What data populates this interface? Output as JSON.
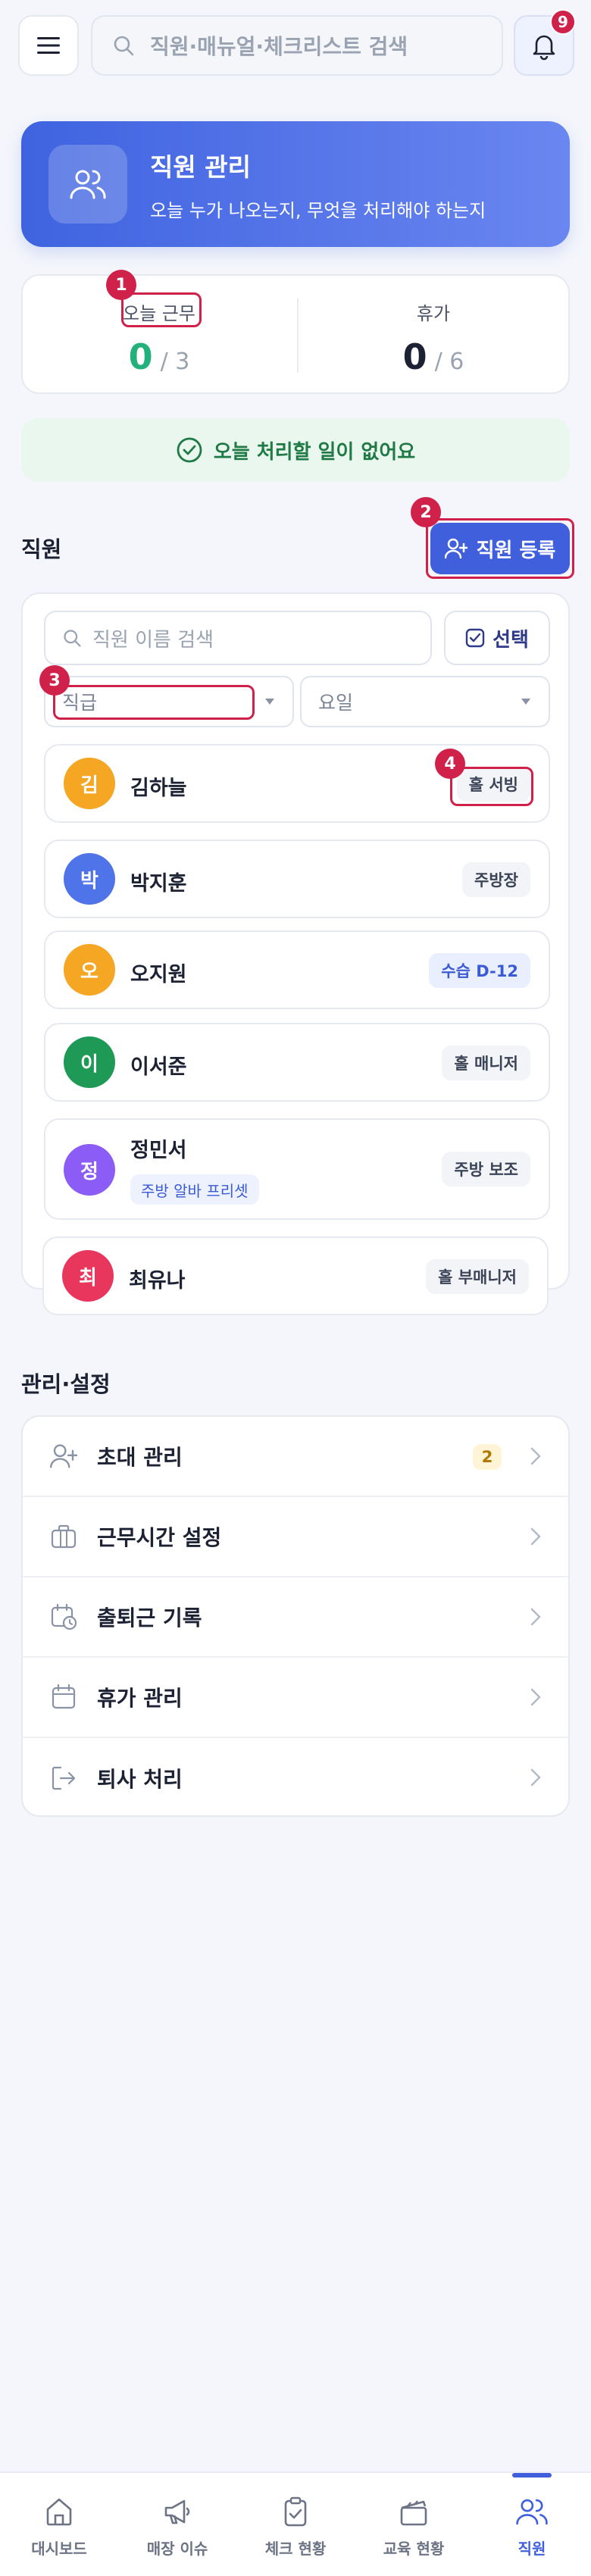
{
  "topbar": {
    "search_placeholder": "직원·매뉴얼·체크리스트 검색",
    "notification_count": "9"
  },
  "hero": {
    "title": "직원 관리",
    "subtitle": "오늘 누가 나오는지, 무엇을 처리해야 하는지"
  },
  "stats": {
    "today_work": {
      "label": "오늘 근무",
      "value": "0",
      "total": "/ 3",
      "value_color": "#22b07d"
    },
    "leave": {
      "label": "휴가",
      "value": "0",
      "total": "/ 6",
      "value_color": "#1c2233"
    }
  },
  "today_banner": "오늘 처리할 일이 없어요",
  "staff_section": {
    "title": "직원",
    "register_button": "직원 등록",
    "search_placeholder": "직원 이름 검색",
    "select_button": "선택",
    "filter_grade": "직급",
    "filter_day": "요일",
    "items": [
      {
        "initial": "김",
        "name": "김하늘",
        "role": "홀 서빙",
        "color": "#f5a623"
      },
      {
        "initial": "박",
        "name": "박지훈",
        "role": "주방장",
        "color": "#4f73e8"
      },
      {
        "initial": "오",
        "name": "오지원",
        "role": "수습 D-12",
        "color": "#f5a623",
        "role_style": "blue"
      },
      {
        "initial": "이",
        "name": "이서준",
        "role": "홀 매니저",
        "color": "#1f9a56"
      },
      {
        "initial": "정",
        "name": "정민서",
        "role": "주방 보조",
        "color": "#8b5cf6",
        "preset": "주방 알바 프리셋"
      },
      {
        "initial": "최",
        "name": "최유나",
        "role": "홀 부매니저",
        "color": "#e8365d"
      }
    ]
  },
  "settings_section": {
    "title": "관리·설정",
    "items": [
      {
        "label": "초대 관리",
        "icon": "user-plus-icon",
        "badge": "2"
      },
      {
        "label": "근무시간 설정",
        "icon": "briefcase-icon"
      },
      {
        "label": "출퇴근 기록",
        "icon": "calendar-clock-icon"
      },
      {
        "label": "휴가 관리",
        "icon": "calendar-icon"
      },
      {
        "label": "퇴사 처리",
        "icon": "logout-icon"
      }
    ]
  },
  "annotations": [
    "1",
    "2",
    "3",
    "4"
  ],
  "bottom_nav": [
    {
      "label": "대시보드",
      "icon": "home-icon"
    },
    {
      "label": "매장 이슈",
      "icon": "megaphone-icon"
    },
    {
      "label": "체크 현황",
      "icon": "clipboard-check-icon"
    },
    {
      "label": "교육 현황",
      "icon": "clapperboard-icon"
    },
    {
      "label": "직원",
      "icon": "users-icon",
      "active": true
    }
  ],
  "colors": {
    "primary": "#3f5fdd",
    "annotation": "#d0214a",
    "success": "#22b07d"
  }
}
